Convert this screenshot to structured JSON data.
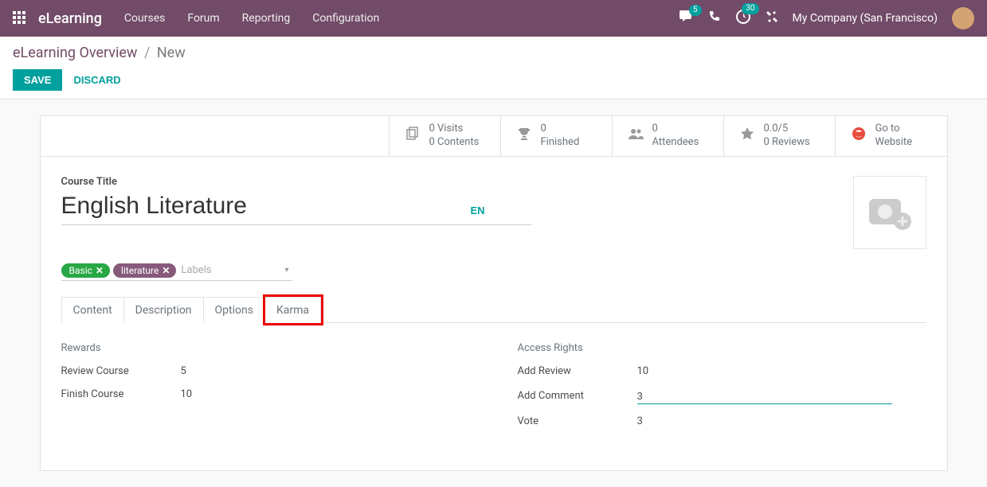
{
  "topbar": {
    "brand": "eLearning",
    "menu": [
      "Courses",
      "Forum",
      "Reporting",
      "Configuration"
    ],
    "chat_badge": "5",
    "activity_badge": "30",
    "company": "My Company (San Francisco)"
  },
  "breadcrumb": {
    "parent": "eLearning Overview",
    "current": "New"
  },
  "buttons": {
    "save": "SAVE",
    "discard": "DISCARD"
  },
  "stats": {
    "visits": "0 Visits",
    "contents": "0 Contents",
    "finished_num": "0",
    "finished_lbl": "Finished",
    "attendees_num": "0",
    "attendees_lbl": "Attendees",
    "rating": "0.0/5",
    "reviews": "0 Reviews",
    "goto1": "Go to",
    "goto2": "Website"
  },
  "course": {
    "title_label": "Course Title",
    "title": "English Literature",
    "lang": "EN",
    "tags": {
      "t1": "Basic",
      "t2": "literature"
    },
    "tag_placeholder": "Labels"
  },
  "tabs": {
    "content": "Content",
    "description": "Description",
    "options": "Options",
    "karma": "Karma"
  },
  "karma": {
    "rewards_title": "Rewards",
    "review_course_lbl": "Review Course",
    "review_course_val": "5",
    "finish_course_lbl": "Finish Course",
    "finish_course_val": "10",
    "access_title": "Access Rights",
    "add_review_lbl": "Add Review",
    "add_review_val": "10",
    "add_comment_lbl": "Add Comment",
    "add_comment_val": "3",
    "vote_lbl": "Vote",
    "vote_val": "3"
  }
}
